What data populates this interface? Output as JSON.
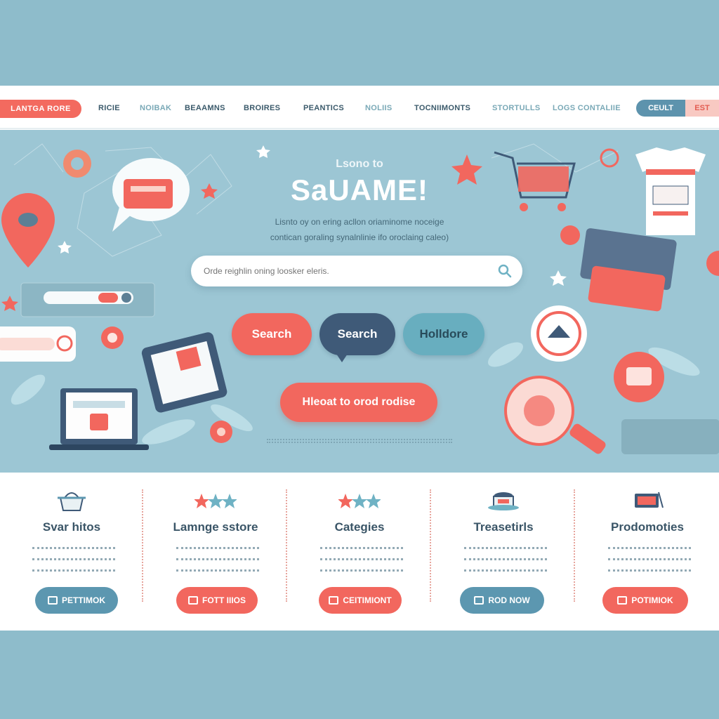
{
  "nav": {
    "brand": "LANTGA RORE",
    "links": [
      "RICIE",
      "NOIBAK",
      "BEAAMNS",
      "BROIRES",
      "PEANTICS",
      "NOLIIS",
      "TOCNIIMONTS",
      "STORTULLS",
      "LOGS CONTALIIE"
    ],
    "login_label": "CEULT",
    "signup_label": "EST"
  },
  "hero": {
    "pretitle": "Lsono to",
    "title": "SaUAME!",
    "subtitle_lines": [
      "Lisnto oy on ering acllon oriaminome noceige",
      "contican goraling synalnlinie ifo oroclaing caleo)"
    ],
    "search_placeholder": "Orde reighlin oning loosker eleris.",
    "buttons": [
      "Search",
      "Search",
      "Holldore"
    ],
    "cta": "Hleoat to orod rodise"
  },
  "cards": [
    {
      "title": "Svar hitos",
      "button": "PETTIMOK",
      "icon": "basket-icon",
      "style": "teal"
    },
    {
      "title": "Lamnge sstore",
      "button": "FOTT IIIOS",
      "icon": "stars-icon",
      "style": "coral"
    },
    {
      "title": "Categies",
      "button": "CEITIMIONT",
      "icon": "stars-icon",
      "style": "coral"
    },
    {
      "title": "Treasetirls",
      "button": "ROD NOW",
      "icon": "cup-icon",
      "style": "teal"
    },
    {
      "title": "Prodomoties",
      "button": "POTIMIOK",
      "icon": "cart-icon",
      "style": "coral"
    }
  ],
  "colors": {
    "coral": "#f2675e",
    "teal": "#5c97b0",
    "navy": "#3f5a78",
    "hero_bg": "#9cc6d4",
    "page_bg": "#8ebccb"
  }
}
